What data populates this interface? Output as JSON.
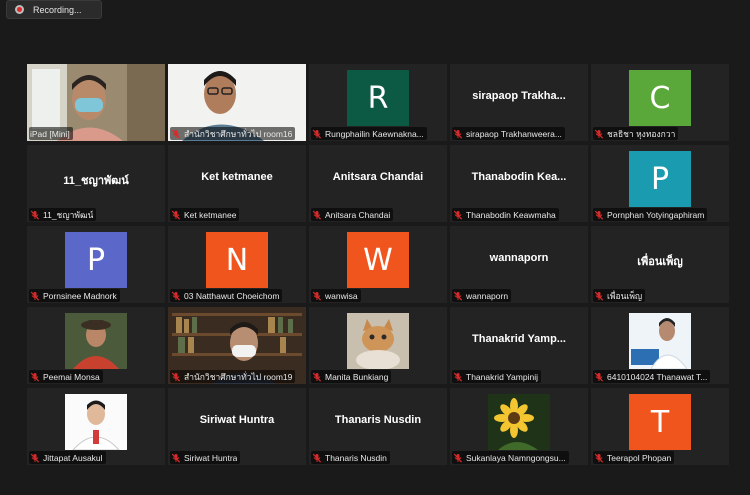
{
  "recording": {
    "label": "Recording..."
  },
  "colors": {
    "bg": "#1a1a1a",
    "tile": "#232323",
    "active_border": "#e6d53c",
    "muted_mic": "#e02828"
  },
  "participants": [
    {
      "label": "iPad [Mini]",
      "kind": "video",
      "video": "person-mask-window",
      "muted": false,
      "active": true
    },
    {
      "label": "สำนักวิชาศึกษาทั่วไป room16",
      "kind": "video",
      "video": "person-glasses-white",
      "muted": true
    },
    {
      "label": "Rungphailin Kaewnakna...",
      "kind": "avatar",
      "letter": "R",
      "color": "#0c5a43",
      "muted": true
    },
    {
      "label": "sirapaop Trakhanweera...",
      "kind": "name",
      "name": "sirapaop  Trakha...",
      "muted": true
    },
    {
      "label": "ชลธิชา หุงทองกวา",
      "kind": "avatar",
      "letter": "C",
      "color": "#5aa83a",
      "muted": true
    },
    {
      "label": "11_ชญาพัฒน์",
      "kind": "name",
      "name": "11_ชญาพัฒน์",
      "muted": true
    },
    {
      "label": "Ket ketmanee",
      "kind": "name",
      "name": "Ket ketmanee",
      "muted": true
    },
    {
      "label": "Anitsara Chandai",
      "kind": "name",
      "name": "Anitsara Chandai",
      "muted": true
    },
    {
      "label": "Thanabodin Keawmaha",
      "kind": "name",
      "name": "Thanabodin  Kea...",
      "muted": true
    },
    {
      "label": "Pornphan Yotyingaphiram",
      "kind": "avatar",
      "letter": "P",
      "color": "#1a9bb0",
      "muted": true
    },
    {
      "label": "Pornsinee Madnork",
      "kind": "avatar",
      "letter": "P",
      "color": "#5c68c9",
      "muted": true
    },
    {
      "label": "03  Natthawut Choeichom",
      "kind": "avatar",
      "letter": "N",
      "color": "#f0551e",
      "muted": true
    },
    {
      "label": "wanwisa",
      "kind": "avatar",
      "letter": "W",
      "color": "#f0551e",
      "muted": true
    },
    {
      "label": "wannaporn",
      "kind": "name",
      "name": "wannaporn",
      "muted": true
    },
    {
      "label": "เพื่อนเพ็ญ",
      "kind": "name",
      "name": "เพื่อนเพ็ญ",
      "muted": true
    },
    {
      "label": "Peemai Monsa",
      "kind": "video",
      "video": "person-red-shirt",
      "muted": true
    },
    {
      "label": "สำนักวิชาศึกษาทั่วไป room19",
      "kind": "video",
      "video": "person-bookshelf",
      "muted": true
    },
    {
      "label": "Manita Bunkiang",
      "kind": "video",
      "video": "cat",
      "muted": true
    },
    {
      "label": "Thanakrid Yampinij",
      "kind": "name",
      "name": "Thanakrid  Yamp...",
      "muted": true
    },
    {
      "label": "6410104024 Thanawat T...",
      "kind": "video",
      "video": "person-poster",
      "muted": true
    },
    {
      "label": "Jittapat Ausakul",
      "kind": "video",
      "video": "person-white-bg",
      "muted": true
    },
    {
      "label": "Siriwat Huntra",
      "kind": "name",
      "name": "Siriwat Huntra",
      "muted": true
    },
    {
      "label": "Thanaris Nusdin",
      "kind": "name",
      "name": "Thanaris Nusdin",
      "muted": true
    },
    {
      "label": "Sukanlaya Namngongsu...",
      "kind": "video",
      "video": "sunflower",
      "muted": true
    },
    {
      "label": "Teerapol Phopan",
      "kind": "avatar",
      "letter": "T",
      "color": "#f0551e",
      "muted": true
    }
  ]
}
